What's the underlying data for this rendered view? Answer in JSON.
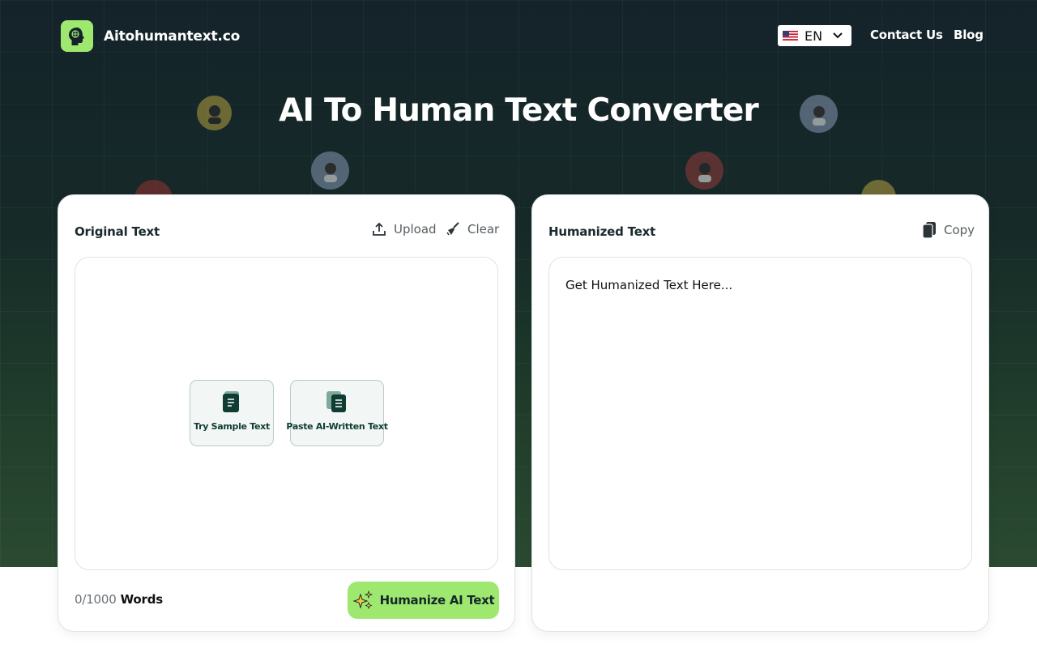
{
  "header": {
    "brand": "Aitohumantext.co",
    "language": "EN",
    "nav": [
      "Contact Us",
      "Blog"
    ]
  },
  "hero": {
    "title": "AI To Human Text Converter"
  },
  "original_panel": {
    "title": "Original Text",
    "upload_label": "Upload",
    "clear_label": "Clear",
    "sample_label": "Try Sample Text",
    "paste_label": "Paste AI-Written Text",
    "word_count": "0/1000",
    "word_unit": "Words",
    "humanize_label": "Humanize AI Text"
  },
  "humanized_panel": {
    "title": "Humanized Text",
    "copy_label": "Copy",
    "placeholder": "Get Humanized Text Here..."
  },
  "colors": {
    "accent": "#9fe870",
    "dark_green": "#0f3d33",
    "hero_bg": "#14232a"
  },
  "icons": [
    "brain-logo-icon",
    "us-flag-icon",
    "chevron-down-icon",
    "upload-icon",
    "broom-icon",
    "copy-icon",
    "document-icon",
    "sparkles-icon",
    "person-avatar-icon"
  ]
}
